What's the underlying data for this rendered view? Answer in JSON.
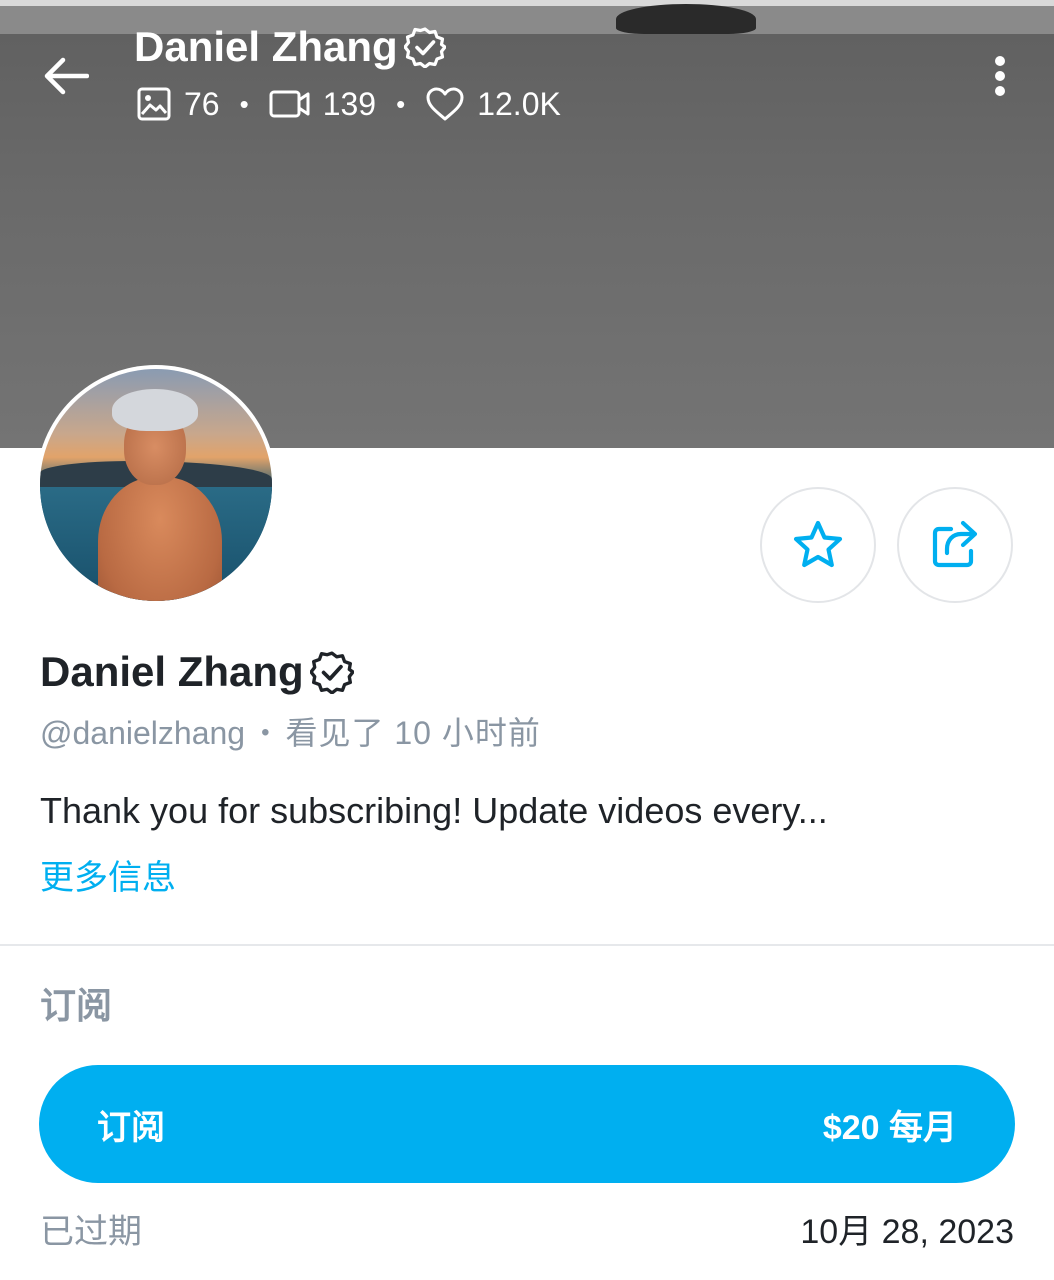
{
  "header": {
    "title": "Daniel Zhang",
    "stats": {
      "photos": "76",
      "videos": "139",
      "likes": "12.0K"
    }
  },
  "profile": {
    "name": "Daniel Zhang",
    "handle": "@danielzhang",
    "last_seen": "看见了 10 小时前",
    "bio": "Thank you for subscribing! Update videos every...",
    "more_info": "更多信息"
  },
  "subscription": {
    "section_title": "订阅",
    "button_label": "订阅",
    "price": "$20 每月",
    "status_label": "已过期",
    "date": "10月 28, 2023"
  },
  "icons": {
    "back": "arrow-left-icon",
    "verified": "verified-badge-icon",
    "photos": "image-icon",
    "videos": "video-camera-icon",
    "likes": "heart-icon",
    "more": "more-vertical-icon",
    "favorite": "star-icon",
    "share": "share-icon"
  },
  "colors": {
    "accent": "#00aff0",
    "text_primary": "#1f2328",
    "text_secondary": "#8a96a3",
    "cover": "#6a6a6a"
  }
}
